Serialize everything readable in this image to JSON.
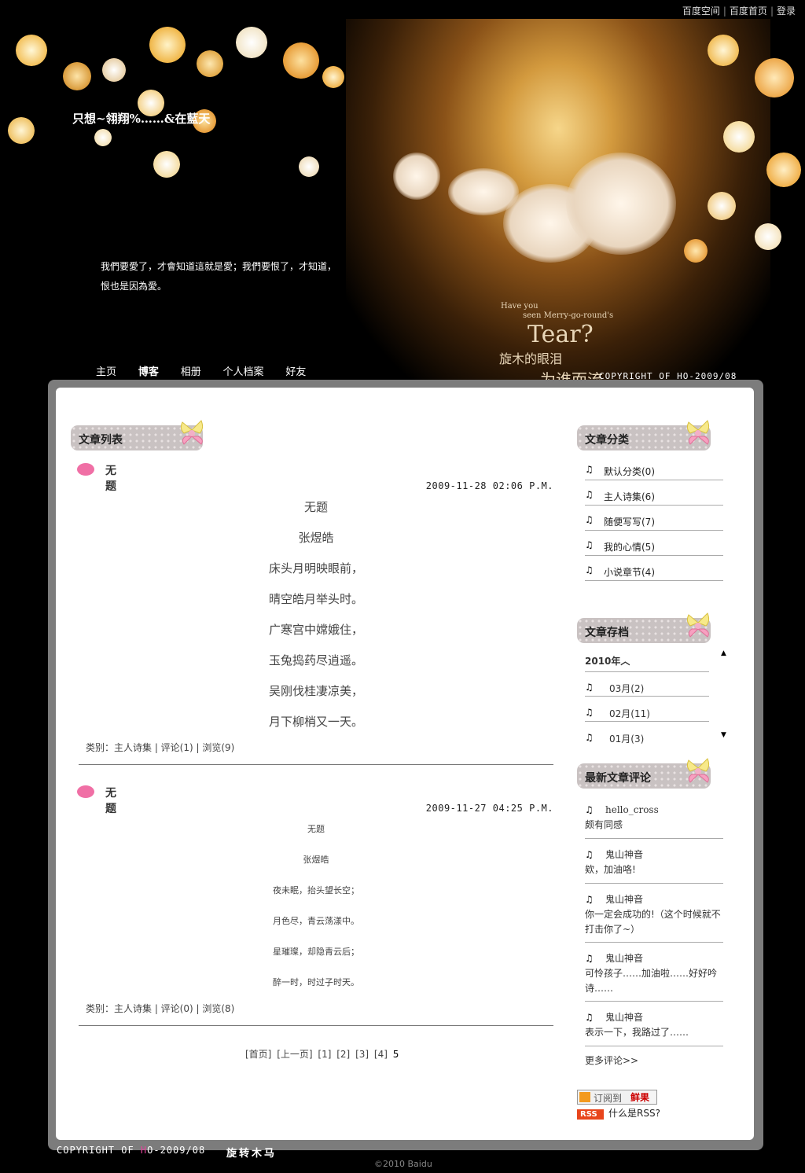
{
  "toplinks": {
    "space": "百度空间",
    "home": "百度首页",
    "login": "登录"
  },
  "header": {
    "blog_title": "只想~翎翔%……&在藍天",
    "description": "我們要愛了，才會知道這就是愛；我們要恨了，才知道，恨也是因為愛。",
    "tear_line1": "Have you",
    "tear_line2": "seen Merry-go-round's",
    "tear_big": "Tear?",
    "tear_cn1": "旋木的眼泪",
    "tear_cn2": "为谁而流",
    "copyright": "COPYRIGHT OF HO-2009/08"
  },
  "nav": [
    {
      "label": "主页",
      "active": false
    },
    {
      "label": "博客",
      "active": true
    },
    {
      "label": "相册",
      "active": false
    },
    {
      "label": "个人档案",
      "active": false
    },
    {
      "label": "好友",
      "active": false
    }
  ],
  "left": {
    "heading": "文章列表",
    "posts": [
      {
        "title": "无题",
        "date": "2009-11-28 02:06 P.M.",
        "lines": [
          "无题",
          "张煜皓",
          "床头月明映眼前，",
          "晴空皓月举头时。",
          "广寒宫中嫦娥住，",
          "玉兔捣药尽逍遥。",
          "吴刚伐桂凄凉美，",
          "月下柳梢又一天。"
        ],
        "meta": "类别：主人诗集 | 评论(1) | 浏览(9)"
      },
      {
        "title": "无题",
        "date": "2009-11-27 04:25 P.M.",
        "lines": [
          "无题",
          "张煜皓",
          "夜未眠，抬头望长空；",
          "月色尽，青云荡漾中。",
          "星璀璨，却隐青云后；",
          "醉一时，时过子时天。"
        ],
        "meta": "类别：主人诗集 | 评论(0) | 浏览(8)"
      }
    ],
    "pager": {
      "first": "[首页]",
      "prev": "[上一页]",
      "p1": "[1]",
      "p2": "[2]",
      "p3": "[3]",
      "p4": "[4]",
      "current": "5"
    }
  },
  "right": {
    "categories_heading": "文章分类",
    "categories": [
      "默认分类(0)",
      "主人诗集(6)",
      "随便写写(7)",
      "我的心情(5)",
      "小说章节(4)"
    ],
    "archive_heading": "文章存档",
    "archive_year": "2010年︿",
    "archive_months": [
      "03月(2)",
      "02月(11)",
      "01月(3)"
    ],
    "comments_heading": "最新文章评论",
    "comments": [
      {
        "author": "hello_cross",
        "text": "颇有同感"
      },
      {
        "author": "鬼山神音",
        "text": "欸，加油咯!"
      },
      {
        "author": "鬼山神音",
        "text": "你一定会成功的!（这个时候就不打击你了~）"
      },
      {
        "author": "鬼山神音",
        "text": "可怜孩子……加油啦……好好吟诗……"
      },
      {
        "author": "鬼山神音",
        "text": "表示一下，我路过了……"
      }
    ],
    "more_comments": "更多评论>>",
    "subscribe_label": "订阅到",
    "subscribe_target": "鲜果",
    "rss_tag": "RSS",
    "rss_help": "什么是RSS?"
  },
  "footer": {
    "copyright_a": "COPYRIGHT OF ",
    "copyright_mark": "H",
    "copyright_b": "O-2009/08",
    "title_cn": "旋转木马",
    "baidu": "©2010 Baidu"
  },
  "icons": {
    "note": "music-note-icon",
    "bullet": "pink-dot-icon",
    "bow": "ribbon-bow-icon"
  },
  "colors": {
    "accent_pink": "#f06fa5",
    "panel_gray": "#7c7c7c",
    "background": "#000000"
  }
}
